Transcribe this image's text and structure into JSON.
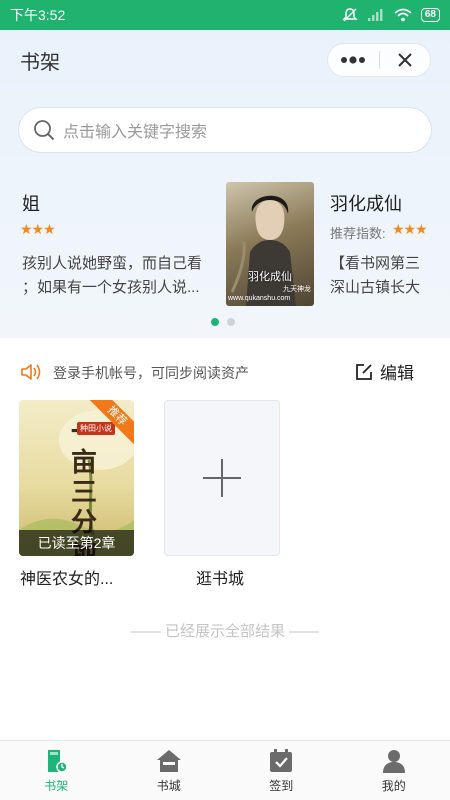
{
  "status_bar": {
    "time": "下午3:52",
    "battery": "68"
  },
  "header": {
    "title": "书架"
  },
  "search": {
    "placeholder": "点击输入关键字搜索"
  },
  "carousel": {
    "left_partial": {
      "title": "姐",
      "desc_line1": "孩别人说她野蛮，而自己看",
      "desc_line2": "；如果有一个女孩别人说..."
    },
    "current": {
      "title": "羽化成仙",
      "rec_label": "推荐指数:",
      "desc_line1": "【看书网第三",
      "desc_line2": "深山古镇长大",
      "cover_title": "羽化成仙",
      "cover_author": "九天神龙",
      "cover_site": "www.qukanshu.com"
    },
    "page_count": 2,
    "active_index": 0
  },
  "notice": {
    "text": "登录手机帐号，可同步阅读资产",
    "edit_label": "编辑"
  },
  "shelf": {
    "books": [
      {
        "name": "神医农女的...",
        "progress": "已读至第2章",
        "badge": "推荐",
        "cover_title": "一亩三分地",
        "cover_tag": "种田小说"
      }
    ],
    "add_label": "逛书城"
  },
  "end_text": "—— 已经展示全部结果 ——",
  "tabbar": {
    "items": [
      {
        "label": "书架",
        "active": true
      },
      {
        "label": "书城",
        "active": false
      },
      {
        "label": "签到",
        "active": false
      },
      {
        "label": "我的",
        "active": false
      }
    ]
  },
  "colors": {
    "accent": "#1fb47a",
    "status_bar": "#20b26f",
    "star": "#f08a1c",
    "ribbon": "#f07a1a"
  }
}
